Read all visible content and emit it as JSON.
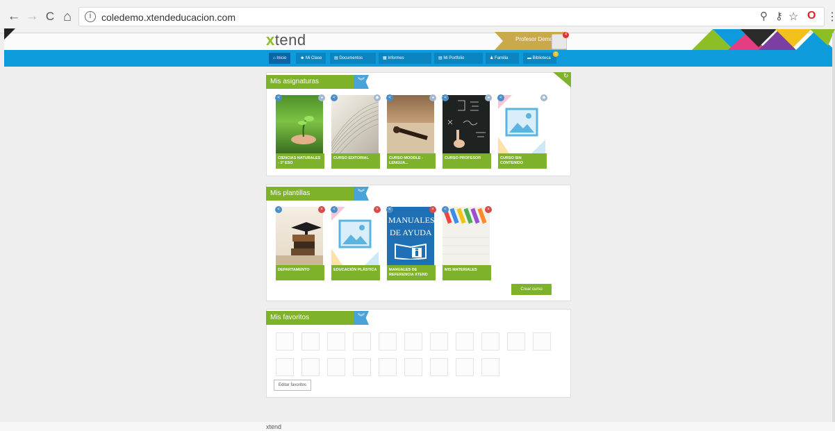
{
  "browser": {
    "url": "coledemo.xtendeducacion.com",
    "back": "←",
    "forward": "→",
    "reload": "C",
    "home": "⌂",
    "info": "i",
    "zoom": "⚲",
    "key": "⚷",
    "star": "☆",
    "opera": "O",
    "menu": "⋮"
  },
  "app": {
    "logo_x": "x",
    "logo_rest": "tend",
    "user_name": "Profesor Demo",
    "notifications": "4",
    "brand_color": "#7db22a",
    "nav_color": "#0d9bdc"
  },
  "nav": [
    {
      "label": "Inicio",
      "icon": "home-icon"
    },
    {
      "label": "Mi Clase",
      "icon": "users-icon"
    },
    {
      "label": "Documentos",
      "icon": "document-icon"
    },
    {
      "label": "Informes",
      "icon": "report-icon"
    },
    {
      "label": "Mi Portfolio",
      "icon": "portfolio-icon"
    },
    {
      "label": "Familia",
      "icon": "family-icon"
    },
    {
      "label": "Biblioteca",
      "icon": "library-icon"
    }
  ],
  "library_badge": "1",
  "asignaturas": {
    "title": "Mis asignaturas",
    "cards": [
      {
        "label": "CIENCIAS NATURALES - 1º ESO"
      },
      {
        "label": "CURSO EDITORIAL"
      },
      {
        "label": "CURSO MOODLE - LENGUA..."
      },
      {
        "label": "CURSO PROFESOR"
      },
      {
        "label": "CURSO SIN CONTENIDO"
      }
    ]
  },
  "plantillas": {
    "title": "Mis plantillas",
    "cards": [
      {
        "label": "DEPARTAMENTO"
      },
      {
        "label": "EDUCACIÓN PLÁSTICA"
      },
      {
        "label": "MANUALES DE REFERENCIA XTEND"
      },
      {
        "label": "MIS MATERIALES"
      }
    ],
    "manual_line1": "MANUALES",
    "manual_line2": "DE AYUDA",
    "create_button": "Crear curso"
  },
  "favoritos": {
    "title": "Mis favoritos",
    "edit_button": "Editar favoritos"
  },
  "footer": {
    "logo": "xtend"
  }
}
